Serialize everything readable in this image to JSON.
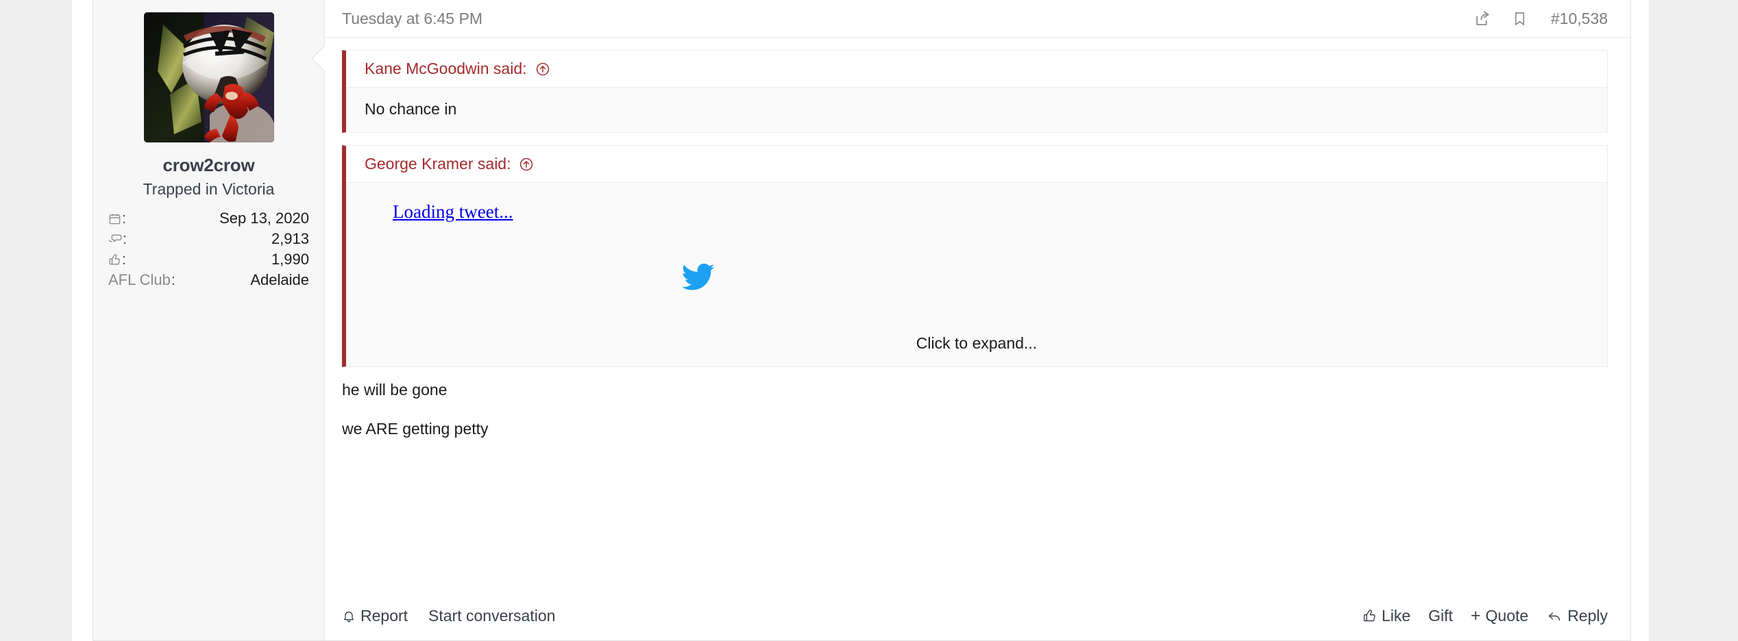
{
  "post": {
    "date": "Tuesday at 6:45 PM",
    "number": "#10,538",
    "share_icon": "share-icon",
    "bookmark_icon": "bookmark-icon"
  },
  "user": {
    "name": "crow2crow",
    "title": "Trapped in Victoria",
    "avatar_alt": "van-halen-5150-album-art",
    "stats": [
      {
        "icon": "calendar-icon",
        "label": "",
        "colon": ":",
        "value": "Sep 13, 2020"
      },
      {
        "icon": "messages-icon",
        "label": "",
        "colon": ":",
        "value": "2,913"
      },
      {
        "icon": "thumbs-up-icon",
        "label": "",
        "colon": ":",
        "value": "1,990"
      },
      {
        "icon": "",
        "label": "AFL Club",
        "colon": ":",
        "value": "Adelaide"
      }
    ]
  },
  "quotes": [
    {
      "author_said": "Kane McGoodwin said:",
      "jump_icon": "circle-arrow-up-icon",
      "body": "No chance in",
      "type": "text"
    },
    {
      "author_said": "George Kramer said:",
      "jump_icon": "circle-arrow-up-icon",
      "type": "tweet",
      "tweet_link": "Loading tweet...",
      "tweet_icon": "twitter-bird-icon",
      "expand_label": "Click to expand..."
    }
  ],
  "message": {
    "paragraphs": [
      "he will be gone",
      "we ARE getting petty"
    ]
  },
  "footer": {
    "left": [
      {
        "icon": "bell-icon",
        "label": "Report"
      },
      {
        "icon": "",
        "label": "Start conversation"
      }
    ],
    "right": [
      {
        "icon": "thumbs-up-icon",
        "label": "Like"
      },
      {
        "icon": "",
        "label": "Gift"
      },
      {
        "icon": "plus-icon",
        "label": "Quote"
      },
      {
        "icon": "reply-arrow-icon",
        "label": "Reply"
      }
    ]
  },
  "colors": {
    "page_bg": "#efefef",
    "card_bg": "#ffffff",
    "sidebar_bg": "#f7f7f7",
    "quote_accent": "#a32b2b",
    "link_blue": "#0000ee",
    "twitter_blue": "#1da1f2",
    "text": "#1b1b1b",
    "muted": "#7d7d7d"
  }
}
